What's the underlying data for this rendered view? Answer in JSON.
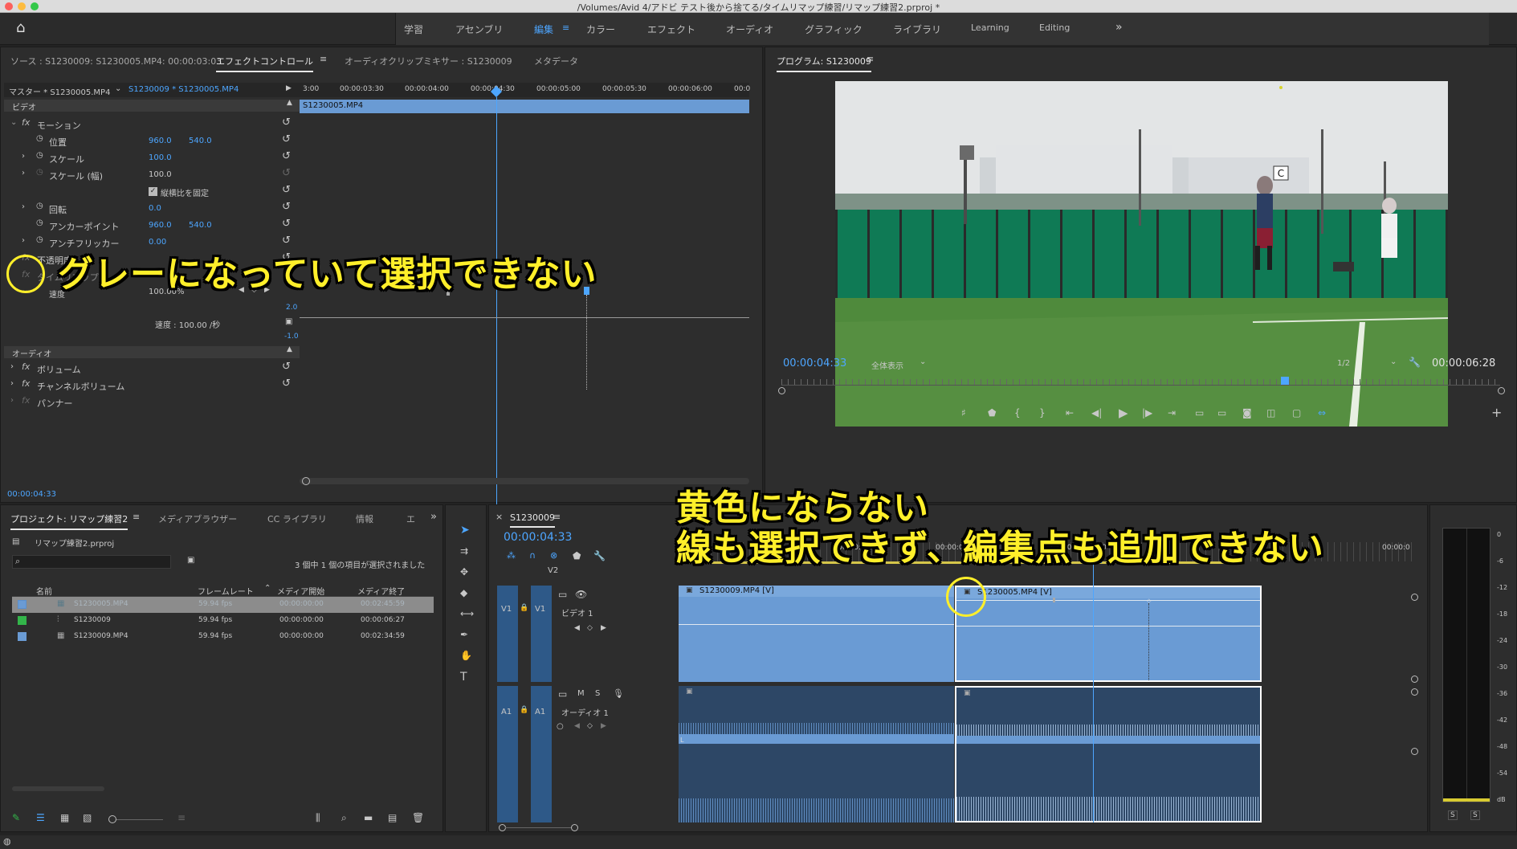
{
  "window": {
    "title": "/Volumes/Avid 4/アドビ テスト後から捨てる/タイムリマップ練習/リマップ練習2.prproj *"
  },
  "workspaces": [
    "学習",
    "アセンブリ",
    "編集",
    "カラー",
    "エフェクト",
    "オーディオ",
    "グラフィック",
    "ライブラリ",
    "Learning",
    "Editing"
  ],
  "source_panel": {
    "tabs": [
      "ソース : S1230009: S1230005.MP4: 00:00:03:03",
      "エフェクトコントロール",
      "オーディオクリップミキサー : S1230009",
      "メタデータ"
    ],
    "master_label": "マスター * S1230005.MP4",
    "seq_label": "S1230009 * S1230005.MP4",
    "ruler": [
      "3:00",
      "00:00:03:30",
      "00:00:04:00",
      "00:00:04:30",
      "00:00:05:00",
      "00:00:05:30",
      "00:00:06:00",
      "00:0"
    ],
    "clip_label": "S1230005.MP4",
    "video_header": "ビデオ",
    "motion": "モーション",
    "position": {
      "label": "位置",
      "x": "960.0",
      "y": "540.0"
    },
    "scale": {
      "label": "スケール",
      "value": "100.0"
    },
    "scale_w": {
      "label": "スケール (幅)",
      "value": "100.0"
    },
    "uniform": "縦横比を固定",
    "rotation": {
      "label": "回転",
      "value": "0.0"
    },
    "anchor": {
      "label": "アンカーポイント",
      "x": "960.0",
      "y": "540.0"
    },
    "flicker": {
      "label": "アンチフリッカー",
      "value": "0.00"
    },
    "opacity": "不透明度",
    "timeremap": "タイムリマップ",
    "speed": {
      "label": "速度",
      "value": "100.00%"
    },
    "speed_rate": "速度 : 100.00 /秒",
    "graph_max": "2.0",
    "graph_min": "-1.0",
    "audio_header": "オーディオ",
    "volume": "ボリューム",
    "channel_volume": "チャンネルボリューム",
    "panner": "パンナー",
    "timecode": "00:00:04:33"
  },
  "program": {
    "title": "プログラム: S1230009",
    "timecode": "00:00:04:33",
    "fit": "全体表示",
    "res": "1/2",
    "duration": "00:00:06:28",
    "court_sign": "C"
  },
  "project": {
    "tabs": [
      "プロジェクト: リマップ練習2",
      "メディアブラウザー",
      "CC ライブラリ",
      "情報",
      "エ"
    ],
    "file": "リマップ練習2.prproj",
    "status": "3 個中 1 個の項目が選択されました",
    "columns": [
      "名前",
      "フレームレート",
      "メディア開始",
      "メディア終了"
    ],
    "rows": [
      {
        "name": "S1230005.MP4",
        "fps": "59.94 fps",
        "start": "00:00:00:00",
        "end": "00:02:45:59",
        "color": "#6a9bd4"
      },
      {
        "name": "S1230009",
        "fps": "59.94 fps",
        "start": "00:00:00:00",
        "end": "00:00:06:27",
        "color": "#33b54a"
      },
      {
        "name": "S1230009.MP4",
        "fps": "59.94 fps",
        "start": "00:00:00:00",
        "end": "00:02:34:59",
        "color": "#6a9bd4"
      }
    ]
  },
  "timeline": {
    "tab": "S1230009",
    "timecode": "00:00:04:33",
    "ruler": [
      "00:00:02:0",
      "00:00:03:00",
      "00:00:05:00",
      "00:00:0"
    ],
    "v2": "V2",
    "v1": "V1",
    "a1": "A1",
    "video_track": "ビデオ 1",
    "audio_track": "オーディオ 1",
    "clip1": "S1230009.MP4 [V]",
    "clip2": "S1230005.MP4 [V]"
  },
  "meter": {
    "scale": [
      "0",
      "-6",
      "-12",
      "-18",
      "-24",
      "-30",
      "-36",
      "-42",
      "-48",
      "-54",
      "dB"
    ],
    "solo": [
      "S",
      "S"
    ]
  },
  "annotations": {
    "a1": "グレーになっていて選択できない",
    "a2": "黄色にならない",
    "a3": "線も選択できず、編集点も追加できない"
  }
}
